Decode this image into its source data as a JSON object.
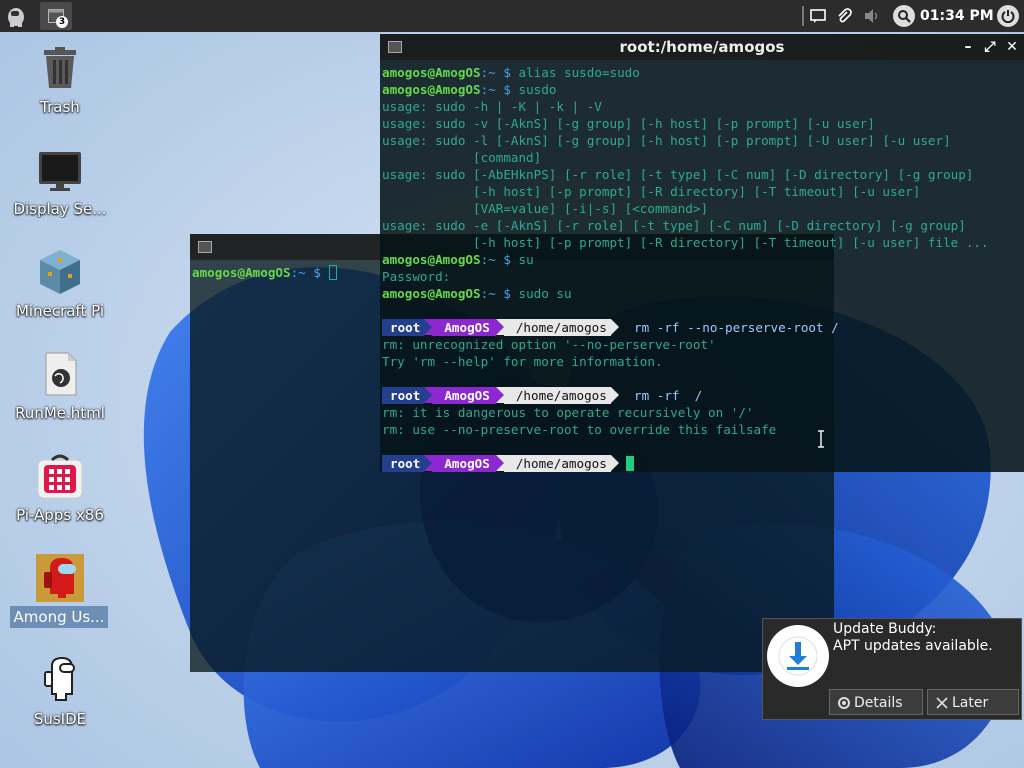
{
  "panel": {
    "task_count": "3",
    "clock": "01:34 PM"
  },
  "desktop": {
    "icons": [
      {
        "label": "Trash",
        "icon": "trash-icon"
      },
      {
        "label": "Display Se...",
        "icon": "monitor-icon"
      },
      {
        "label": "Minecraft Pi",
        "icon": "minecraft-icon"
      },
      {
        "label": "RunMe.html",
        "icon": "html-file-icon"
      },
      {
        "label": "Pi-Apps x86",
        "icon": "pi-apps-icon"
      },
      {
        "label": "Among Us...",
        "icon": "among-us-icon"
      },
      {
        "label": "SusIDE",
        "icon": "sus-ide-icon"
      }
    ]
  },
  "terminal_back": {
    "title": "",
    "user": "amogos@AmogOS",
    "sep": ":~ $"
  },
  "terminal_front": {
    "title": "root:/home/amogos",
    "user": "amogos@AmogOS",
    "sep": ":~ $",
    "lines": {
      "l1_cmd": " alias susdo=sudo",
      "l2_cmd": " susdo",
      "o1": "usage: sudo -h | -K | -k | -V",
      "o2": "usage: sudo -v [-AknS] [-g group] [-h host] [-p prompt] [-u user]",
      "o3": "usage: sudo -l [-AknS] [-g group] [-h host] [-p prompt] [-U user] [-u user]",
      "o4": "            [command]",
      "o5": "usage: sudo [-AbEHknPS] [-r role] [-t type] [-C num] [-D directory] [-g group]",
      "o6": "            [-h host] [-p prompt] [-R directory] [-T timeout] [-u user]",
      "o7": "            [VAR=value] [-i|-s] [<command>]",
      "o8": "usage: sudo -e [-AknS] [-r role] [-t type] [-C num] [-D directory] [-g group]",
      "o9": "            [-h host] [-p prompt] [-R directory] [-T timeout] [-u user] file ...",
      "l3_cmd": " su",
      "o10": "Password:",
      "l4_cmd": " sudo su",
      "pl_root": "root",
      "pl_host": "AmogOS",
      "pl_dir": "/home/amogos",
      "r1_cmd": "  rm -rf --no-perserve-root /",
      "e1": "rm: unrecognized option '--no-perserve-root'",
      "e2": "Try 'rm --help' for more information.",
      "r2_cmd": "  rm -rf  /",
      "e3": "rm: it is dangerous to operate recursively on '/'",
      "e4": "rm: use --no-preserve-root to override this failsafe"
    }
  },
  "notification": {
    "title": "Update Buddy:",
    "body": "APT updates available.",
    "details_label": "Details",
    "later_label": "Later"
  },
  "colors": {
    "user_prompt": "#66d94a",
    "path": "#4aa0e6",
    "output": "#2fa890",
    "powerline_root": "#233f8e",
    "powerline_host": "#8b28d0",
    "powerline_dir": "#e8e8e8"
  }
}
